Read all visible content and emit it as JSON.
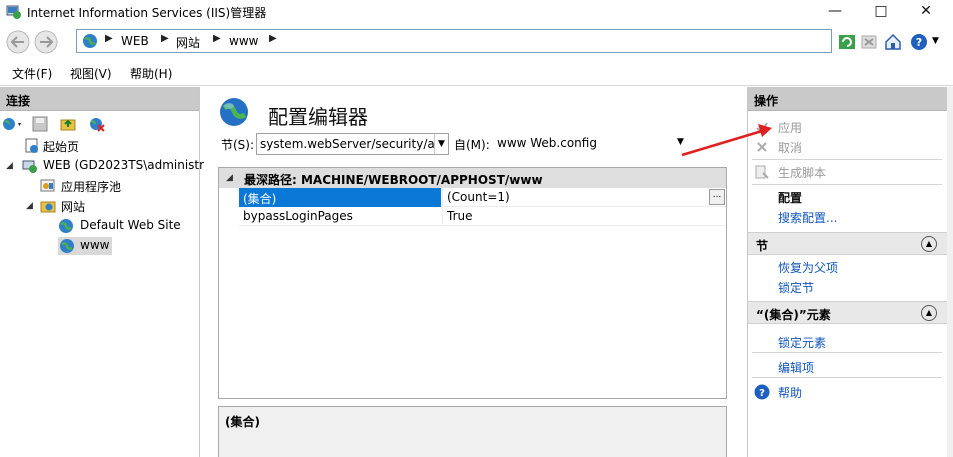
{
  "window": {
    "title": "Internet Information Services (IIS)管理器"
  },
  "address": {
    "crumbs": [
      "WEB",
      "网站",
      "www"
    ]
  },
  "menu": [
    "文件(F)",
    "视图(V)",
    "帮助(H)"
  ],
  "left": {
    "header": "连接",
    "tree": {
      "start": "起始页",
      "server": "WEB (GD2023TS\\administr",
      "apppools": "应用程序池",
      "sites": "网站",
      "default_site": "Default Web Site",
      "www": "www"
    }
  },
  "center": {
    "title": "配置编辑器",
    "section_label": "节(S):",
    "section_value": "system.webServer/security/au",
    "from_label": "自(M):",
    "from_value": "www Web.config",
    "grid": {
      "header": "最深路径: MACHINE/WEBROOT/APPHOST/www",
      "rows": [
        {
          "key": "(集合)",
          "value": "(Count=1)"
        },
        {
          "key": "bypassLoginPages",
          "value": "True"
        }
      ],
      "ellipsis": "..."
    },
    "desc": "(集合)"
  },
  "right": {
    "header": "操作",
    "apply": "应用",
    "cancel": "取消",
    "gen_script": "生成脚本",
    "config": "配置",
    "search_config": "搜索配置...",
    "section_head": "节",
    "revert": "恢复为父项",
    "lock_section": "锁定节",
    "collection_head": "“(集合)”元素",
    "lock_element": "锁定元素",
    "edit_items": "编辑项",
    "help": "帮助"
  },
  "colors": {
    "selection": "#0a78d7",
    "link": "#1155bb",
    "arrow": "#e02020"
  }
}
